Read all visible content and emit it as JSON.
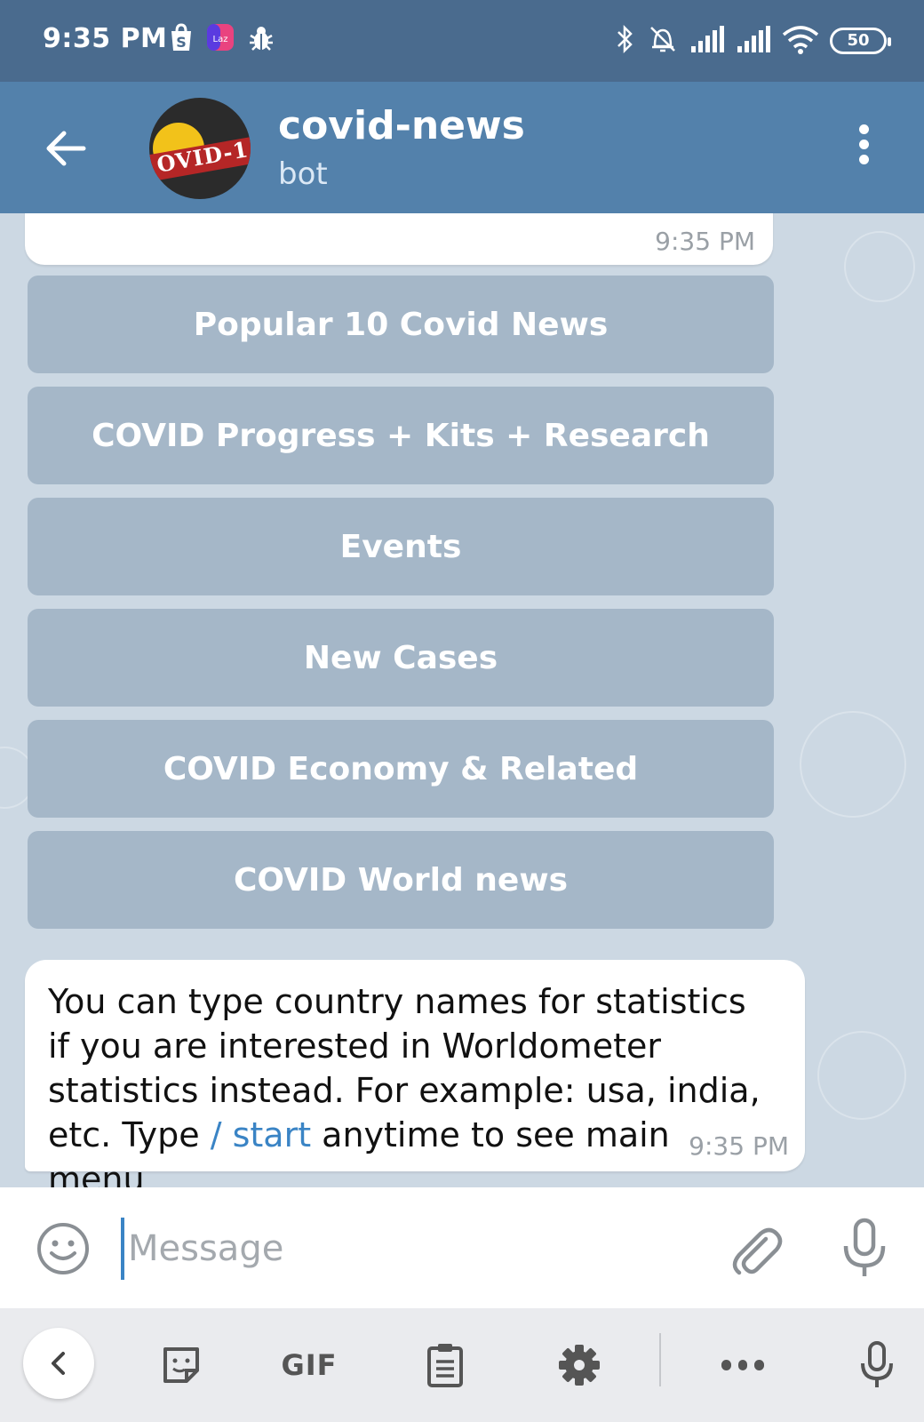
{
  "status_bar": {
    "time": "9:35 PM",
    "battery": "50",
    "left_icons": [
      "shopee-icon",
      "lazada-icon",
      "bug-icon"
    ],
    "right_icons": [
      "bluetooth-icon",
      "alarm-off-icon",
      "signal-icon",
      "signal-icon",
      "wifi-icon"
    ]
  },
  "header": {
    "title": "covid-news",
    "subtitle": "bot",
    "avatar_text": "OVID-1"
  },
  "messages": {
    "previous_time": "9:35 PM",
    "keyboard_buttons": [
      "Popular 10 Covid News",
      "COVID Progress + Kits + Research",
      "Events",
      "New Cases",
      "COVID Economy & Related",
      "COVID World news"
    ],
    "bot_message": {
      "text_before": "You can type country names for statistics if you are interested in Worldometer statistics instead. For example: usa, india, etc. Type ",
      "command": "/ start",
      "text_after": " anytime to see main menu",
      "time": "9:35 PM"
    }
  },
  "input": {
    "placeholder": "Message",
    "value": ""
  },
  "keyboard_toolbar": {
    "gif_label": "GIF",
    "items": [
      "back-icon",
      "sticker-icon",
      "gif-icon",
      "clipboard-icon",
      "settings-icon",
      "more-icon",
      "microphone-icon"
    ]
  },
  "colors": {
    "status_bar": "#4a6b8e",
    "header": "#5381ab",
    "chat_background": "#ccd8e3",
    "keyboard_button": "#a5b7c8",
    "link": "#3a84c5"
  }
}
